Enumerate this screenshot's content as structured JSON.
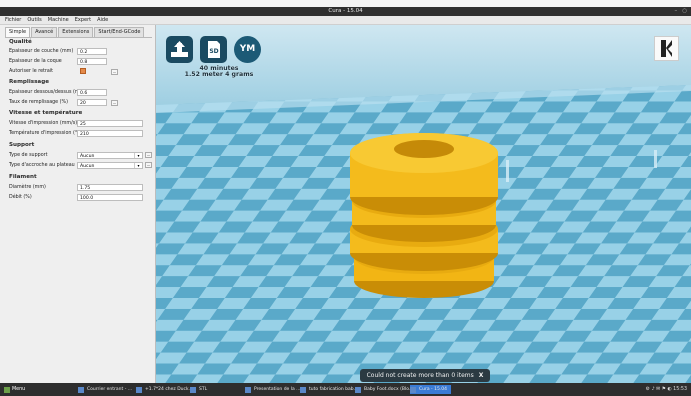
{
  "window": {
    "title": "Cura - 15.04",
    "controls": [
      "–",
      "○"
    ]
  },
  "menu": [
    "Fichier",
    "Outils",
    "Machine",
    "Expert",
    "Aide"
  ],
  "tabs": [
    {
      "label": "Simple",
      "active": true
    },
    {
      "label": "Avancé",
      "active": false
    },
    {
      "label": "Extensions",
      "active": false
    },
    {
      "label": "Start/End-GCode",
      "active": false
    }
  ],
  "settings": {
    "qualite": {
      "title": "Qualité",
      "layer_height_label": "Epaisseur de couche (mm)",
      "layer_height": "0.2",
      "shell_label": "Epaisseur de la coque",
      "shell": "0.8",
      "retract_label": "Autoriser le retrait",
      "retract_checked": true,
      "dots": "..."
    },
    "remplissage": {
      "title": "Remplissage",
      "bottom_top_label": "Epaisseur dessous/dessus (mm)",
      "bottom_top": "0.6",
      "fill_label": "Taux de remplissage (%)",
      "fill": "20",
      "dots": "..."
    },
    "vitesse": {
      "title": "Vitesse et température",
      "speed_label": "Vitesse d'impression (mm/s)",
      "speed": "25",
      "temp_label": "Température d'impression (°C)",
      "temp": "210"
    },
    "support": {
      "title": "Support",
      "type_label": "Type de support",
      "type": "Aucun",
      "adhesion_label": "Type d'accroche au plateau",
      "adhesion": "Aucun",
      "dots": "..."
    },
    "filament": {
      "title": "Filament",
      "diameter_label": "Diamètre (mm)",
      "diameter": "1.75",
      "flow_label": "Débit (%)",
      "flow": "100.0"
    }
  },
  "viewport": {
    "ym_label": "YM",
    "sd_label": "SD",
    "print_time": "40 minutes",
    "print_material": "1.52 meter 4 grams",
    "toast": "Could not create more than 0 items",
    "toast_close": "X",
    "colors": {
      "bed_light": "#9ad3ea",
      "bed_dark": "#5aa8c8",
      "object": "#f2b514",
      "object_shadow": "#c98d06"
    }
  },
  "taskbar": {
    "menu": "Menu",
    "tasks": [
      "Courrier entrant - ...",
      "+1.7*24 chez Duck...",
      "STL",
      "Presentation de la ...",
      "tuto fabrication bab...",
      "Baby Foot.docx (Blo...",
      "Cura - 15.04"
    ],
    "time": "15:53"
  }
}
